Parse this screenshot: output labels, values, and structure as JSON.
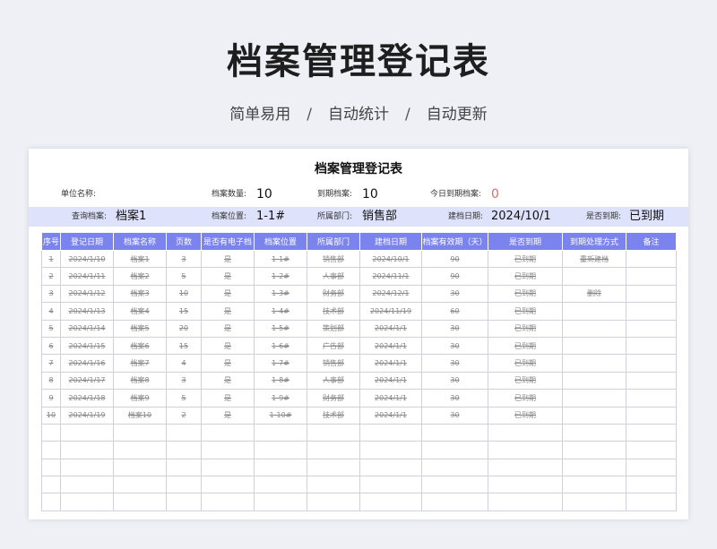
{
  "hero": {
    "title": "档案管理登记表",
    "features": [
      "简单易用",
      "自动统计",
      "自动更新"
    ],
    "separator": "/"
  },
  "sheet": {
    "title": "档案管理登记表",
    "row1": {
      "unit_label": "单位名称:",
      "unit_value": "",
      "count_label": "档案数量:",
      "count_value": "10",
      "due_label": "到期档案:",
      "due_value": "10",
      "today_due_label": "今日到期档案:",
      "today_due_value": "0"
    },
    "row2": {
      "query_label": "查询档案:",
      "query_value": "档案1",
      "position_label": "档案位置:",
      "position_value": "1-1#",
      "dept_label": "所属部门:",
      "dept_value": "销售部",
      "date_label": "建档日期:",
      "date_value": "2024/10/1",
      "expired_label": "是否到期:",
      "expired_value": "已到期"
    },
    "table": {
      "headers": [
        "序号",
        "登记日期",
        "档案名称",
        "页数",
        "是否有电子档",
        "档案位置",
        "所属部门",
        "建档日期",
        "档案有效期（天）",
        "是否到期",
        "到期处理方式",
        "备注"
      ],
      "rows": [
        [
          "1",
          "2024/1/10",
          "档案1",
          "3",
          "是",
          "1-1#",
          "销售部",
          "2024/10/1",
          "90",
          "已到期",
          "重新建档",
          ""
        ],
        [
          "2",
          "2024/1/11",
          "档案2",
          "5",
          "是",
          "1-2#",
          "人事部",
          "2024/11/1",
          "90",
          "已到期",
          "",
          ""
        ],
        [
          "3",
          "2024/1/12",
          "档案3",
          "10",
          "是",
          "1-3#",
          "财务部",
          "2024/12/1",
          "30",
          "已到期",
          "删除",
          ""
        ],
        [
          "4",
          "2024/1/13",
          "档案4",
          "15",
          "是",
          "1-4#",
          "技术部",
          "2024/11/19",
          "60",
          "已到期",
          "",
          ""
        ],
        [
          "5",
          "2024/1/14",
          "档案5",
          "20",
          "是",
          "1-5#",
          "策划部",
          "2024/1/1",
          "30",
          "已到期",
          "",
          ""
        ],
        [
          "6",
          "2024/1/15",
          "档案6",
          "15",
          "是",
          "1-6#",
          "广告部",
          "2024/1/1",
          "30",
          "已到期",
          "",
          ""
        ],
        [
          "7",
          "2024/1/16",
          "档案7",
          "4",
          "是",
          "1-7#",
          "销售部",
          "2024/1/1",
          "30",
          "已到期",
          "",
          ""
        ],
        [
          "8",
          "2024/1/17",
          "档案8",
          "3",
          "是",
          "1-8#",
          "人事部",
          "2024/1/1",
          "30",
          "已到期",
          "",
          ""
        ],
        [
          "9",
          "2024/1/18",
          "档案9",
          "5",
          "是",
          "1-9#",
          "财务部",
          "2024/1/1",
          "30",
          "已到期",
          "",
          ""
        ],
        [
          "10",
          "2024/1/19",
          "档案10",
          "2",
          "是",
          "1-10#",
          "技术部",
          "2024/1/1",
          "30",
          "已到期",
          "",
          ""
        ]
      ]
    }
  },
  "colors": {
    "header_bg": "#7b83ee",
    "query_row_bg": "#dfe2fb",
    "today_due_color": "#e26a6a"
  }
}
